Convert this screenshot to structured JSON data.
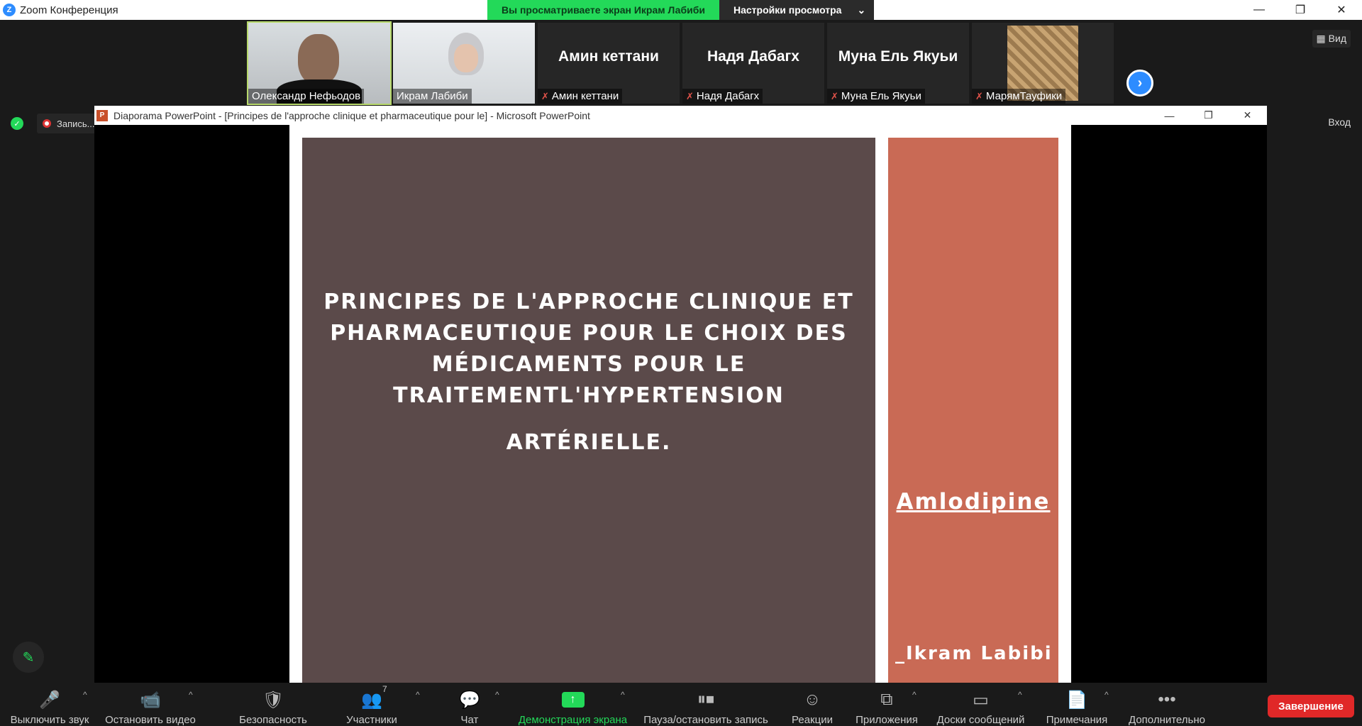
{
  "window": {
    "title": "Zoom Конференция",
    "share_banner": "Вы просматриваете экран Икрам Лабиби",
    "view_settings": "Настройки просмотра"
  },
  "participants": [
    {
      "name": "Олександр   Нефьодов",
      "display": "",
      "muted": false
    },
    {
      "name": "Икрам Лабиби",
      "display": "",
      "muted": false
    },
    {
      "name": "Амин кеттани",
      "display": "Амин кеттани",
      "muted": true
    },
    {
      "name": "Надя Дабагх",
      "display": "Надя Дабагх",
      "muted": true
    },
    {
      "name": "Муна Ель Якуьи",
      "display": "Муна Ель Якуьи",
      "muted": true
    },
    {
      "name": "МарямТауфики",
      "display": "",
      "muted": true
    }
  ],
  "side": {
    "view_label": "Вид",
    "enter_label": "Вход",
    "recording_label": "Запись..."
  },
  "powerpoint": {
    "window_title": "Diaporama PowerPoint - [Principes de l'approche clinique et pharmaceutique pour le] - Microsoft PowerPoint",
    "slide_title": "PRINCIPES DE L'APPROCHE CLINIQUE ET PHARMACEUTIQUE POUR LE CHOIX DES MÉDICAMENTS POUR LE TRAITEMENTL'HYPERTENSION",
    "slide_title_2": "ARTÉRIELLE.",
    "drug": "Amlodipine",
    "author": "_Ikram Labibi",
    "left_color": "#5b4a4a",
    "right_color": "#c96a55"
  },
  "toolbar": {
    "mute": "Выключить звук",
    "video": "Остановить видео",
    "security": "Безопасность",
    "participants": "Участники",
    "participants_count": "7",
    "chat": "Чат",
    "share": "Демонстрация экрана",
    "record": "Пауза/остановить запись",
    "reactions": "Реакции",
    "apps": "Приложения",
    "whiteboards": "Доски сообщений",
    "notes": "Примечания",
    "more": "Дополнительно",
    "end": "Завершение"
  }
}
